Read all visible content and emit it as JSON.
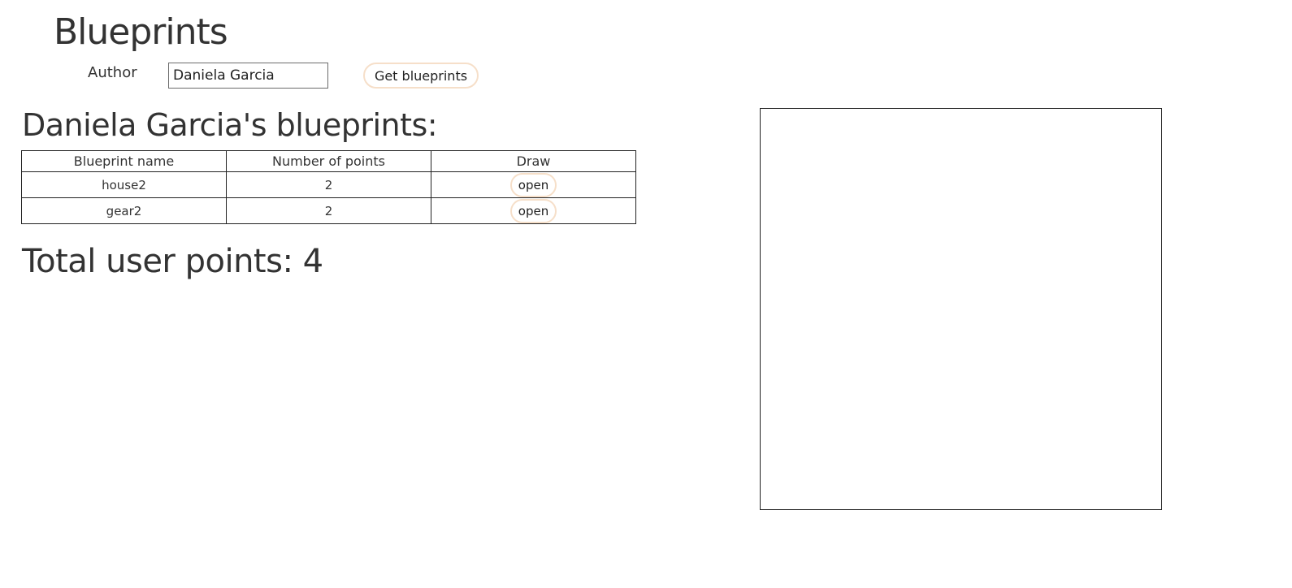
{
  "page": {
    "title": "Blueprints"
  },
  "author_form": {
    "label": "Author",
    "input_value": "Daniela Garcia",
    "button_label": "Get blueprints"
  },
  "blueprints_section": {
    "heading": "Daniela Garcia's blueprints:",
    "columns": [
      "Blueprint name",
      "Number of points",
      "Draw"
    ],
    "rows": [
      {
        "name": "house2",
        "points": "2",
        "action": "open"
      },
      {
        "name": "gear2",
        "points": "2",
        "action": "open"
      }
    ],
    "total_label": "Total user points: 4"
  },
  "colors": {
    "button_border": "#f6dfc9",
    "text": "#333333",
    "canvas_border": "#222222"
  }
}
